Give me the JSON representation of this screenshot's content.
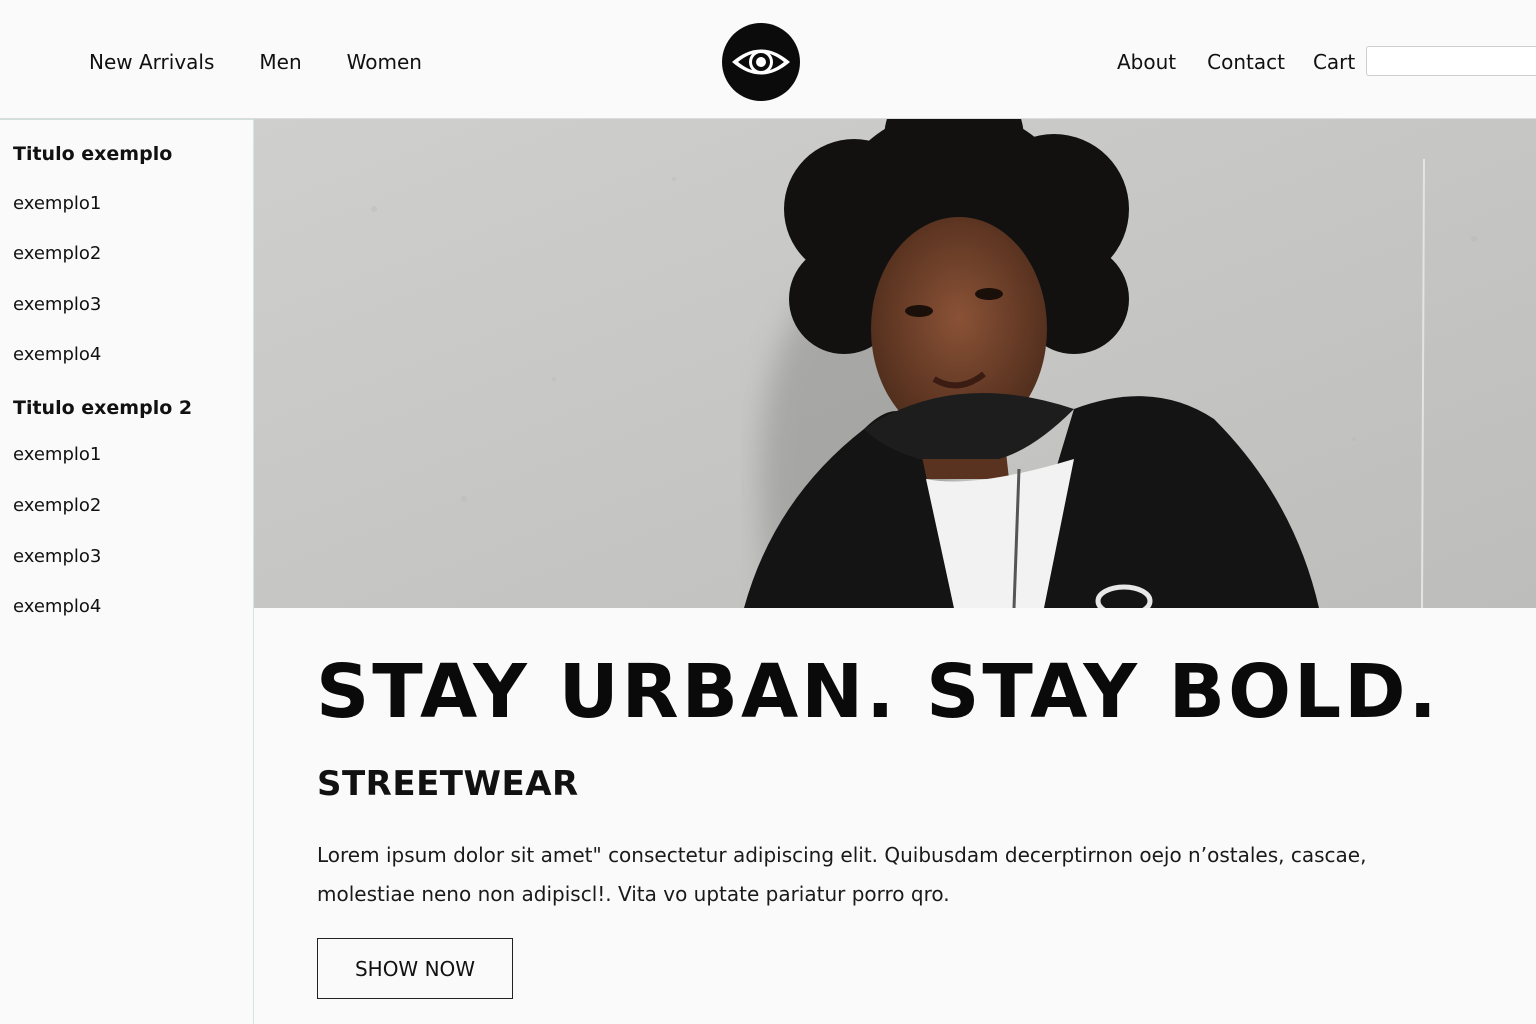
{
  "header": {
    "nav_left": [
      "New Arrivals",
      "Men",
      "Women"
    ],
    "nav_right": [
      "About",
      "Contact",
      "Cart"
    ],
    "search": {
      "value": "",
      "placeholder": ""
    },
    "logo_icon": "eye-icon"
  },
  "sidebar": {
    "sections": [
      {
        "title": "Titulo exemplo",
        "items": [
          "exemplo1",
          "exemplo2",
          "exemplo3",
          "exemplo4"
        ]
      },
      {
        "title": "Titulo exemplo 2",
        "items": [
          "exemplo1",
          "exemplo2",
          "exemplo3",
          "exemplo4"
        ]
      }
    ]
  },
  "hero": {
    "image_subject": "photo",
    "headline": "STAY URBAN. STAY BOLD.",
    "subheadline": "STREETWEAR",
    "body": "Lorem ipsum dolor sit amet\" consectetur adipiscing elit. Quibusdam decerptirnon oejo n’ostales, cascae, molestiae neno non adipiscl!. Vita vo uptate pariatur porro qro.",
    "cta_label": "SHOW NOW"
  },
  "colors": {
    "background": "#fafafa",
    "text": "#111111",
    "hero_wall": "#c9c9c7",
    "jacket": "#111111"
  }
}
